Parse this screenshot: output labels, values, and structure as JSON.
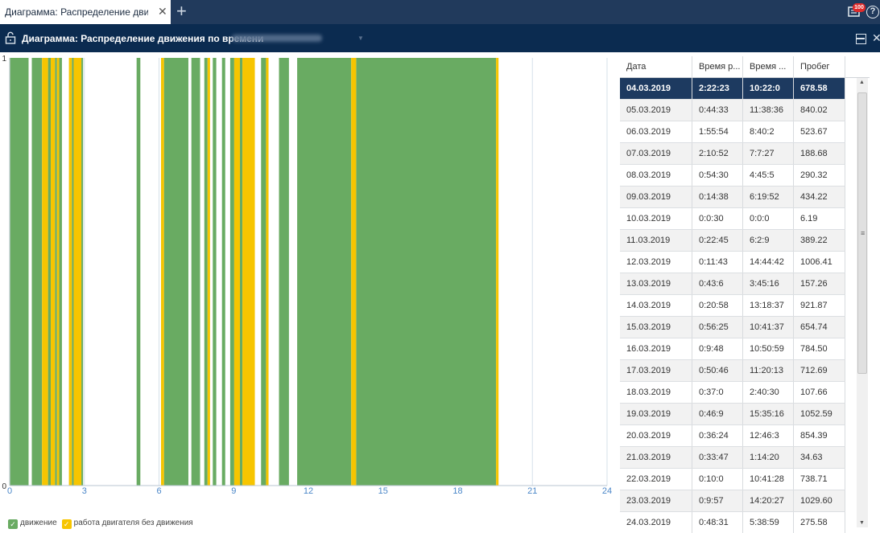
{
  "tab": {
    "title": "Диаграмма: Распределение движ...",
    "close": "✕",
    "add": "+"
  },
  "topbar": {
    "notification_count": "100",
    "help": "?"
  },
  "header": {
    "title": "Диаграмма: Распределение движения по времени",
    "caret": "▼",
    "close": "✕"
  },
  "colors": {
    "movement": "#69ab62",
    "idle": "#f7c500",
    "header": "#0b2b50",
    "tabbar": "#213a5c",
    "selected": "#1d3a60"
  },
  "chart_data": {
    "type": "bar",
    "x_ticks": [
      "0",
      "3",
      "6",
      "9",
      "12",
      "15",
      "18",
      "21",
      "24"
    ],
    "xlim": [
      0,
      24
    ],
    "y_ticks": [
      "0",
      "1"
    ],
    "ylim": [
      0,
      1
    ],
    "series": [
      {
        "name": "движение",
        "color": "#69ab62",
        "intervals": [
          [
            0.02,
            0.76
          ],
          [
            0.89,
            1.3
          ],
          [
            1.54,
            1.65
          ],
          [
            1.82,
            1.9
          ],
          [
            1.99,
            2.1
          ],
          [
            2.5,
            2.57
          ],
          [
            2.88,
            2.95
          ],
          [
            5.1,
            5.25
          ],
          [
            6.2,
            7.18
          ],
          [
            7.3,
            7.65
          ],
          [
            7.82,
            7.95
          ],
          [
            8.16,
            8.3
          ],
          [
            8.53,
            8.66
          ],
          [
            8.86,
            9.02
          ],
          [
            9.25,
            9.35
          ],
          [
            10.1,
            10.3
          ],
          [
            10.82,
            11.22
          ],
          [
            11.55,
            13.72
          ],
          [
            13.92,
            19.54
          ]
        ]
      },
      {
        "name": "работа двигателя без движения",
        "color": "#f7c500",
        "intervals": [
          [
            1.3,
            1.54
          ],
          [
            1.65,
            1.82
          ],
          [
            1.9,
            1.99
          ],
          [
            2.38,
            2.5
          ],
          [
            2.57,
            2.88
          ],
          [
            6.08,
            6.2
          ],
          [
            7.95,
            8.05
          ],
          [
            9.02,
            9.25
          ],
          [
            9.35,
            9.85
          ],
          [
            10.3,
            10.4
          ],
          [
            13.72,
            13.92
          ],
          [
            19.54,
            19.64
          ]
        ]
      }
    ]
  },
  "legend": [
    {
      "label": "движение",
      "color": "#69ab62"
    },
    {
      "label": "работа двигателя без движения",
      "color": "#f7c500"
    }
  ],
  "table": {
    "headers": [
      "Дата",
      "Время р...",
      "Время ...",
      "Пробег"
    ],
    "rows": [
      [
        "04.03.2019",
        "2:22:23",
        "10:22:0",
        "678.58"
      ],
      [
        "05.03.2019",
        "0:44:33",
        "11:38:36",
        "840.02"
      ],
      [
        "06.03.2019",
        "1:55:54",
        "8:40:2",
        "523.67"
      ],
      [
        "07.03.2019",
        "2:10:52",
        "7:7:27",
        "188.68"
      ],
      [
        "08.03.2019",
        "0:54:30",
        "4:45:5",
        "290.32"
      ],
      [
        "09.03.2019",
        "0:14:38",
        "6:19:52",
        "434.22"
      ],
      [
        "10.03.2019",
        "0:0:30",
        "0:0:0",
        "6.19"
      ],
      [
        "11.03.2019",
        "0:22:45",
        "6:2:9",
        "389.22"
      ],
      [
        "12.03.2019",
        "0:11:43",
        "14:44:42",
        "1006.41"
      ],
      [
        "13.03.2019",
        "0:43:6",
        "3:45:16",
        "157.26"
      ],
      [
        "14.03.2019",
        "0:20:58",
        "13:18:37",
        "921.87"
      ],
      [
        "15.03.2019",
        "0:56:25",
        "10:41:37",
        "654.74"
      ],
      [
        "16.03.2019",
        "0:9:48",
        "10:50:59",
        "784.50"
      ],
      [
        "17.03.2019",
        "0:50:46",
        "11:20:13",
        "712.69"
      ],
      [
        "18.03.2019",
        "0:37:0",
        "2:40:30",
        "107.66"
      ],
      [
        "19.03.2019",
        "0:46:9",
        "15:35:16",
        "1052.59"
      ],
      [
        "20.03.2019",
        "0:36:24",
        "12:46:3",
        "854.39"
      ],
      [
        "21.03.2019",
        "0:33:47",
        "1:14:20",
        "34.63"
      ],
      [
        "22.03.2019",
        "0:10:0",
        "10:41:28",
        "738.71"
      ],
      [
        "23.03.2019",
        "0:9:57",
        "14:20:27",
        "1029.60"
      ],
      [
        "24.03.2019",
        "0:48:31",
        "5:38:59",
        "275.58"
      ]
    ]
  },
  "scrollbar": {
    "up": "▲",
    "down": "▼",
    "grip": "≡"
  }
}
